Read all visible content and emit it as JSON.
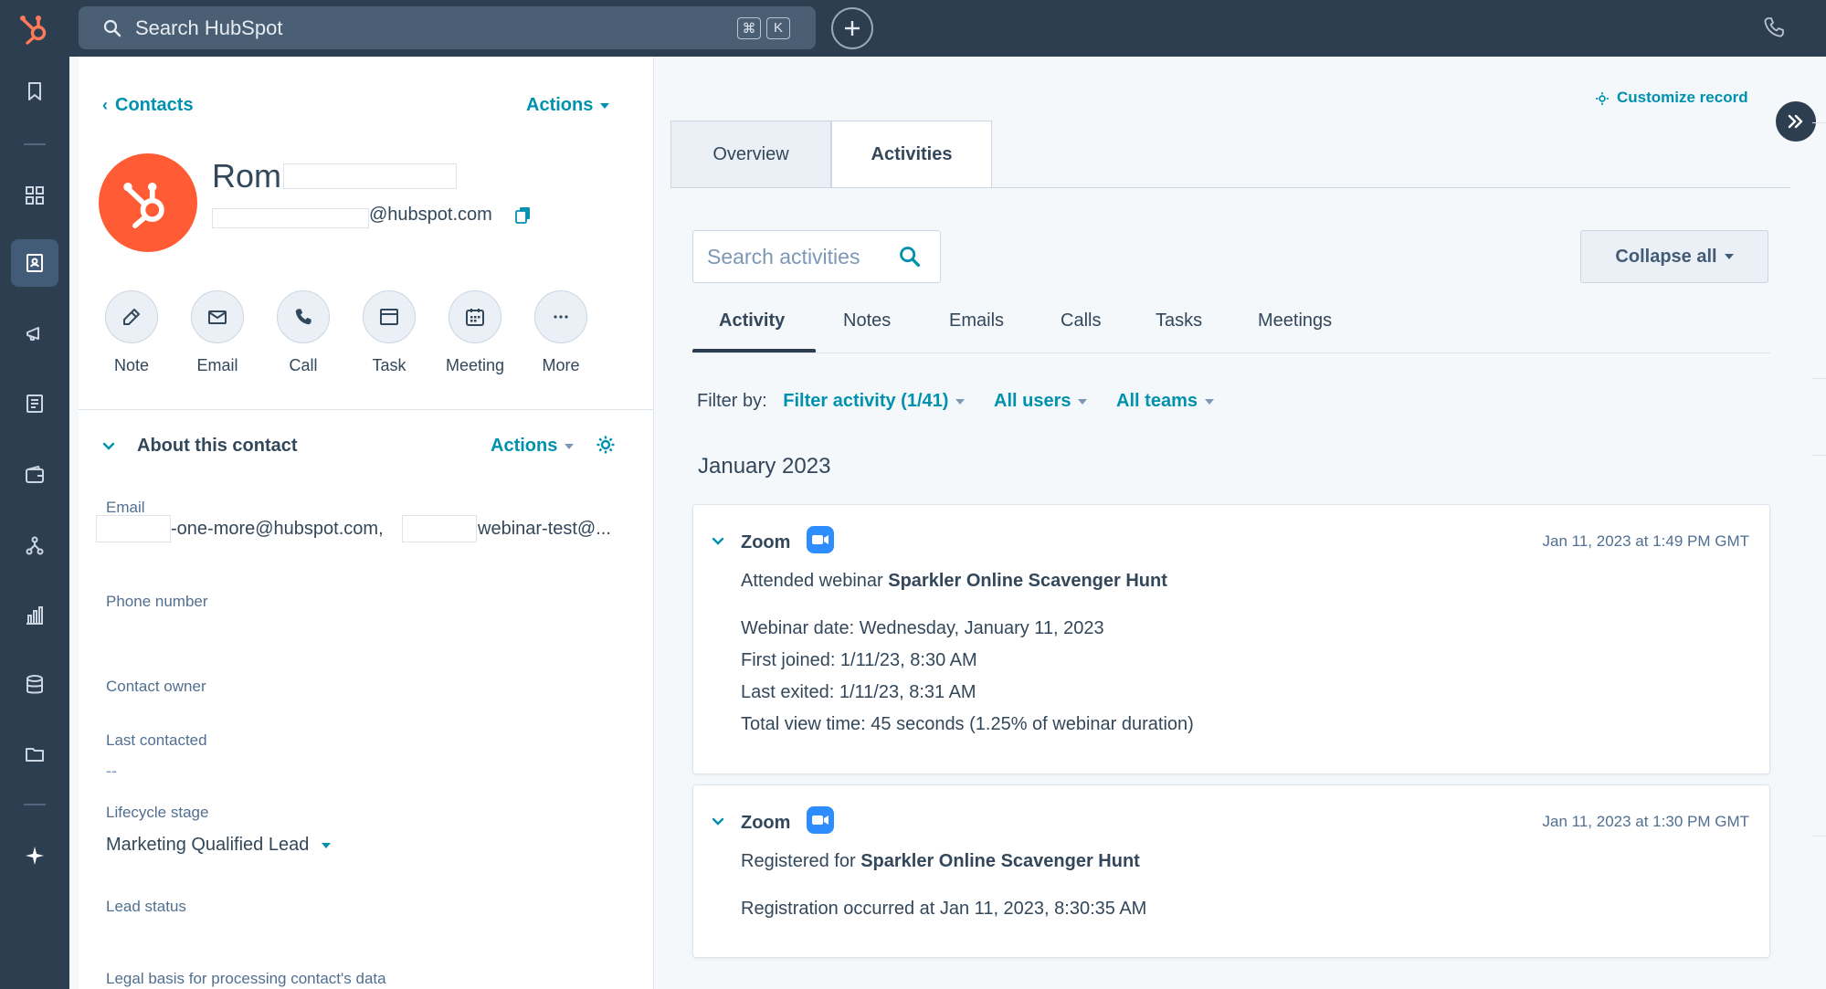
{
  "topbar": {
    "search_placeholder": "Search HubSpot",
    "shortcut_keys": [
      "⌘",
      "K"
    ]
  },
  "contact": {
    "breadcrumb": "Contacts",
    "actions_label": "Actions",
    "name_visible": "Rom",
    "email_visible": "@hubspot.com",
    "quick_actions": [
      "Note",
      "Email",
      "Call",
      "Task",
      "Meeting",
      "More"
    ]
  },
  "about": {
    "title": "About this contact",
    "actions_label": "Actions",
    "email_label": "Email",
    "email_value_1": "-one-more@hubspot.com,",
    "email_value_2": "webinar-test@...",
    "phone_label": "Phone number",
    "owner_label": "Contact owner",
    "last_contacted_label": "Last contacted",
    "last_contacted_value": "--",
    "lifecycle_label": "Lifecycle stage",
    "lifecycle_value": "Marketing Qualified Lead",
    "lead_status_label": "Lead status",
    "legal_basis_label": "Legal basis for processing contact's data"
  },
  "record": {
    "customize_label": "Customize record",
    "tabs": [
      "Overview",
      "Activities"
    ],
    "active_tab": "Activities"
  },
  "activities": {
    "search_placeholder": "Search activities",
    "collapse_label": "Collapse all",
    "subtabs": [
      "Activity",
      "Notes",
      "Emails",
      "Calls",
      "Tasks",
      "Meetings"
    ],
    "filter_by_label": "Filter by:",
    "filter_activity": "Filter activity (1/41)",
    "filter_users": "All users",
    "filter_teams": "All teams",
    "month_header": "January 2023",
    "cards": [
      {
        "source": "Zoom",
        "timestamp": "Jan 11, 2023 at 1:49 PM GMT",
        "headline_prefix": "Attended webinar",
        "headline_bold": "Sparkler Online Scavenger Hunt",
        "details": [
          "Webinar date: Wednesday, January 11, 2023",
          "First joined: 1/11/23, 8:30 AM",
          "Last exited: 1/11/23, 8:31 AM",
          "Total view time: 45 seconds (1.25% of webinar duration)"
        ]
      },
      {
        "source": "Zoom",
        "timestamp": "Jan 11, 2023 at 1:30 PM GMT",
        "headline_prefix": "Registered for",
        "headline_bold": "Sparkler Online Scavenger Hunt",
        "details": [
          "Registration occurred at Jan 11, 2023, 8:30:35 AM"
        ]
      }
    ]
  },
  "colors": {
    "nav_bg": "#2d3e50",
    "link": "#0091ae",
    "avatar": "#ff5c35",
    "zoom": "#2d8cff"
  }
}
